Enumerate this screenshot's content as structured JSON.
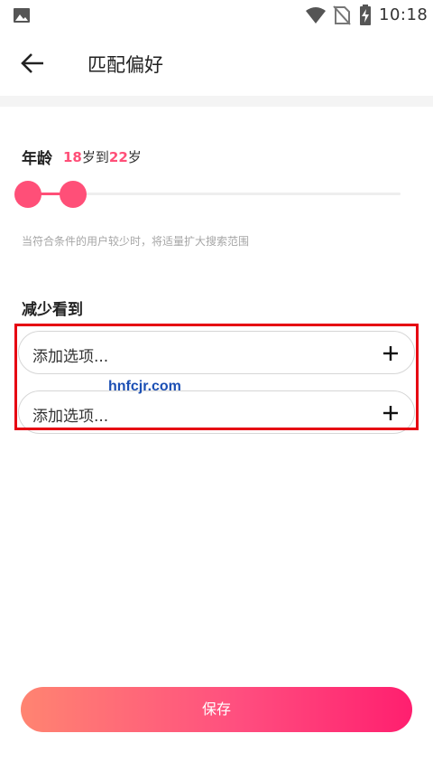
{
  "status_bar": {
    "time": "10:18",
    "icons": [
      "image-icon",
      "wifi-icon",
      "no-sim-icon",
      "battery-charging-icon"
    ]
  },
  "header": {
    "back_icon": "arrow-left-icon",
    "title": "匹配偏好"
  },
  "age": {
    "label": "年龄",
    "min": "18",
    "unit1": "岁到",
    "max": "22",
    "unit2": "岁",
    "hint": "当符合条件的用户较少时，将适量扩大搜索范围"
  },
  "reduce": {
    "title": "减少看到",
    "options": [
      {
        "label": "添加选项...",
        "icon": "plus-icon"
      },
      {
        "label": "添加选项...",
        "icon": "plus-icon"
      }
    ]
  },
  "watermark": "hnfcjr.com",
  "save_label": "保存",
  "colors": {
    "accent": "#ff4f78",
    "highlight_border": "#e60012",
    "button_gradient_start": "#ff8471",
    "button_gradient_end": "#ff1f6f"
  }
}
